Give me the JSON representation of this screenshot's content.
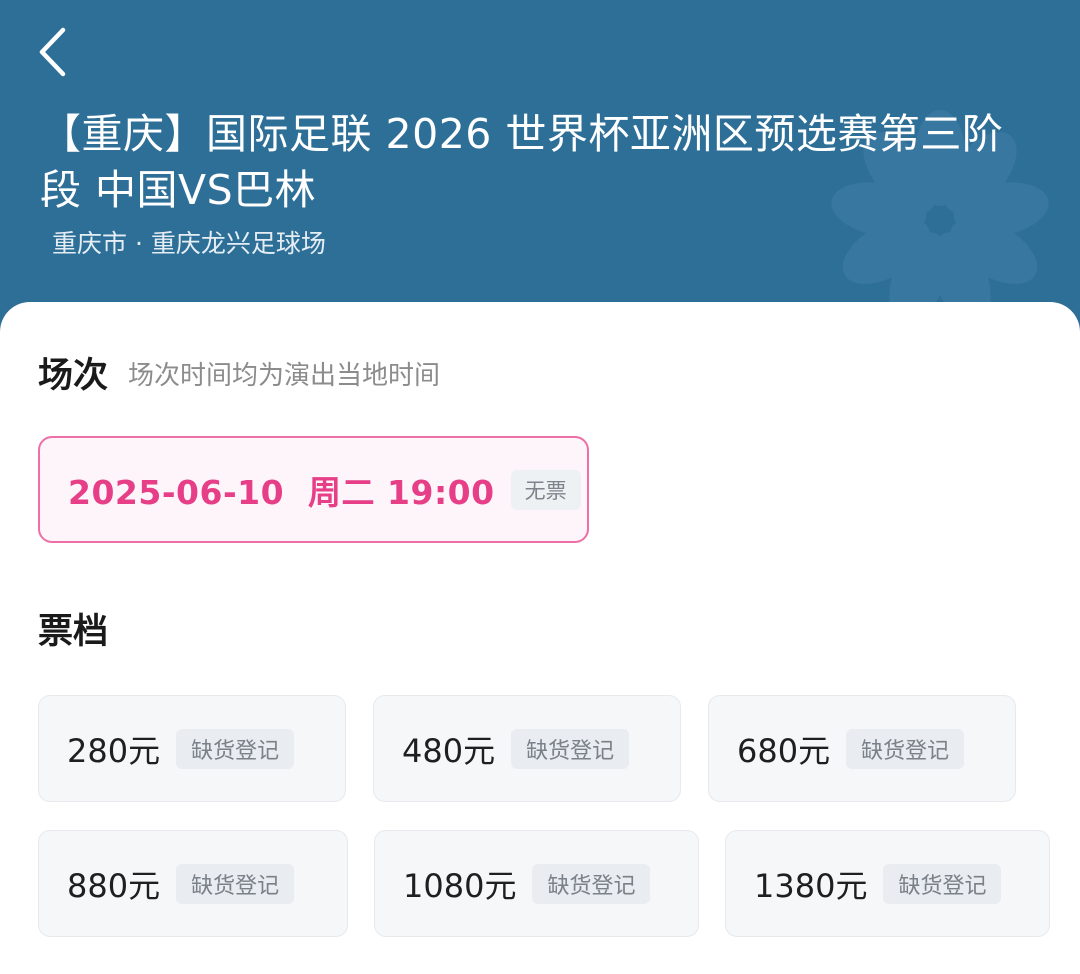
{
  "header": {
    "back_icon": "chevron-left-icon",
    "title": "【重庆】国际足联 2026 世界杯亚洲区预选赛第三阶段 中国VS巴林",
    "venue": "重庆市 · 重庆龙兴足球场",
    "bg_color": "#2e6f98"
  },
  "session": {
    "title": "场次",
    "hint": "场次时间均为演出当地时间",
    "selected": {
      "datetime": "2025-06-10  周二 19:00",
      "badge": "无票"
    },
    "accent_color": "#e63e87"
  },
  "tiers": {
    "title": "票档",
    "items": [
      {
        "price": "280元",
        "badge": "缺货登记"
      },
      {
        "price": "480元",
        "badge": "缺货登记"
      },
      {
        "price": "680元",
        "badge": "缺货登记"
      },
      {
        "price": "880元",
        "badge": "缺货登记"
      },
      {
        "price": "1080元",
        "badge": "缺货登记"
      },
      {
        "price": "1380元",
        "badge": "缺货登记"
      }
    ]
  }
}
